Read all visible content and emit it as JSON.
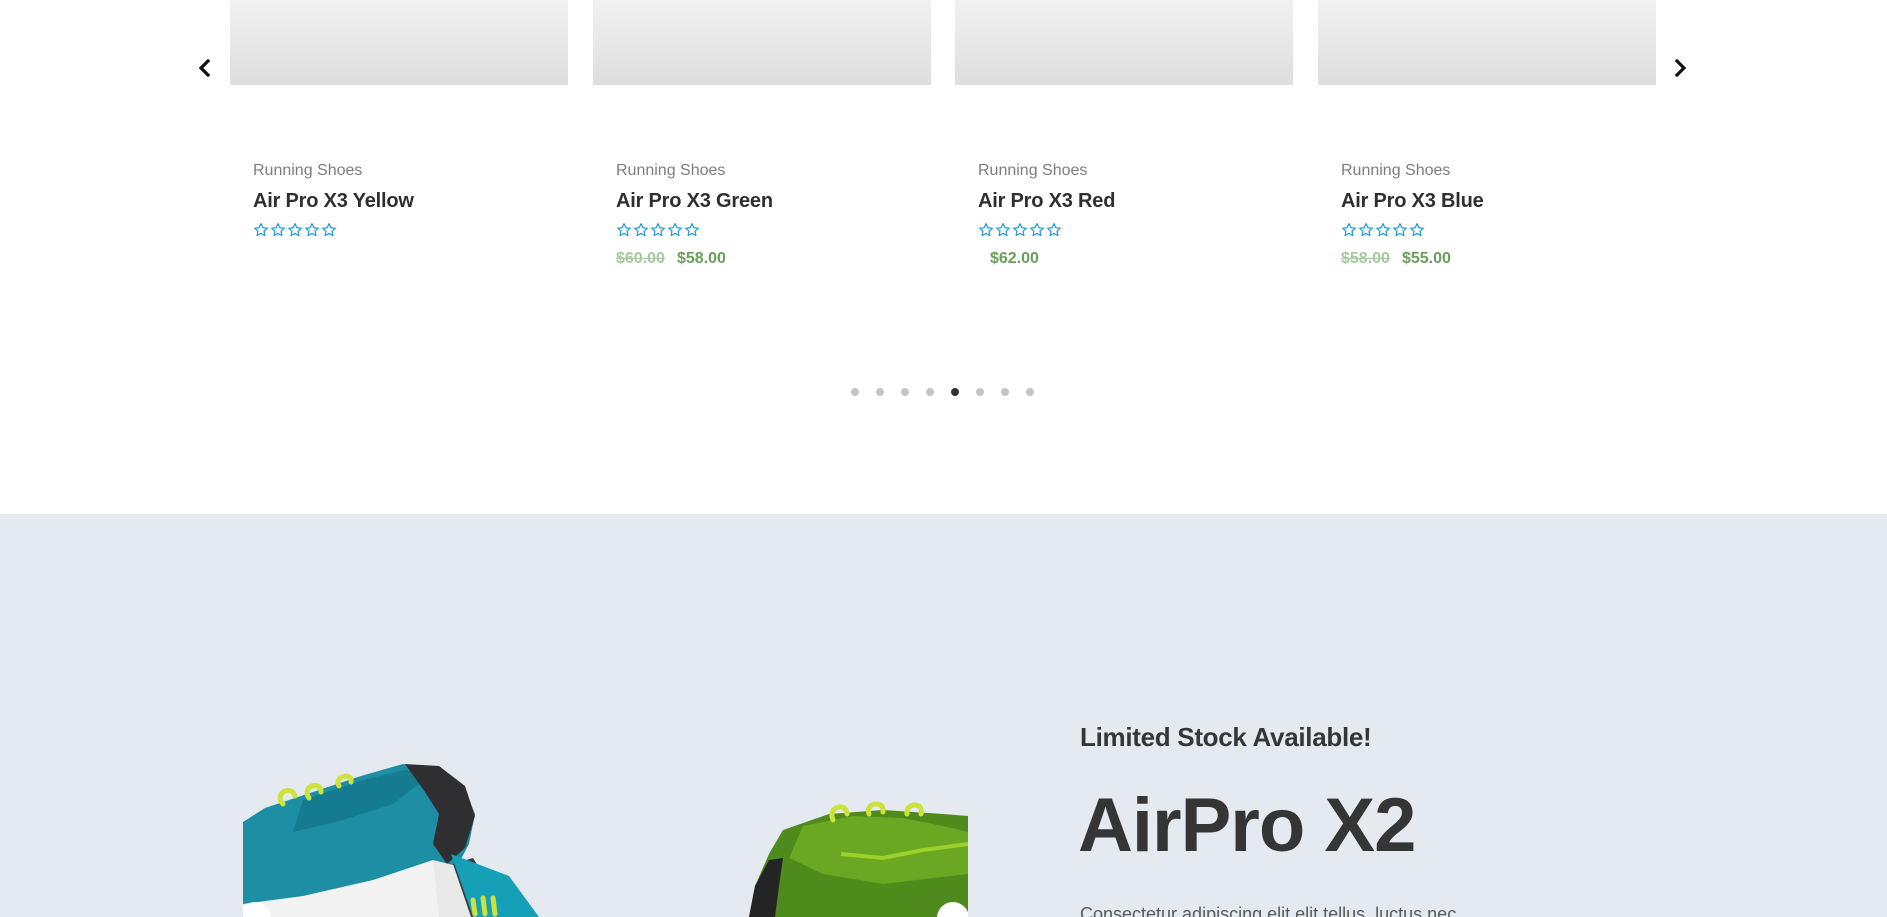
{
  "carousel": {
    "prev_label": "Previous",
    "next_label": "Next",
    "products": [
      {
        "category": "Running Shoes",
        "title": "Air Pro X3 Yellow",
        "rating": 0,
        "price_old": "",
        "price": ""
      },
      {
        "category": "Running Shoes",
        "title": "Air Pro X3 Green",
        "rating": 0,
        "price_old": "$60.00",
        "price": "$58.00"
      },
      {
        "category": "Running Shoes",
        "title": "Air Pro X3 Red",
        "rating": 0,
        "price_old": "",
        "price": "$62.00"
      },
      {
        "category": "Running Shoes",
        "title": "Air Pro X3 Blue",
        "rating": 0,
        "price_old": "$58.00",
        "price": "$55.00"
      }
    ],
    "pagination": {
      "total": 8,
      "active": 5
    },
    "colors": {
      "star": "#1e9bd7",
      "price": "#6a9e5d",
      "price_old": "#a6caa0"
    }
  },
  "promo": {
    "eyebrow": "Limited Stock Available!",
    "headline": "AirPro X2",
    "body": "Consectetur adipiscing elit elit tellus, luctus nec",
    "background": "#e5eaf1"
  }
}
